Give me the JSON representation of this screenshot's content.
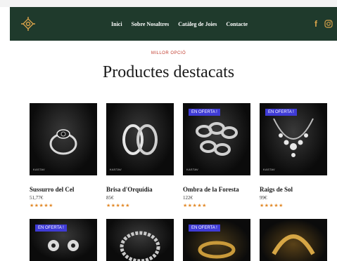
{
  "header": {
    "nav": [
      "Inici",
      "Sobre Nosaltres",
      "Catàleg de Joies",
      "Contacte"
    ],
    "social": {
      "facebook": "f",
      "instagram_icon": "instagram-icon"
    },
    "logo_icon": "jewel-logo-icon",
    "bg_color": "#1f3a2c"
  },
  "section": {
    "kicker": "MILLOR OPCIÓ",
    "title": "Productes destacats"
  },
  "products": [
    {
      "name": "Sussurro del Cel",
      "price": "51,77€",
      "badge": "",
      "brand": "KASTAV",
      "rating": 5,
      "icon": "ring-icon"
    },
    {
      "name": "Brisa d'Orquídia",
      "price": "85€",
      "badge": "",
      "brand": "KASTAV",
      "rating": 5,
      "icon": "hoop-earrings-icon"
    },
    {
      "name": "Ombra de la Foresta",
      "price": "122€",
      "badge": "EN OFERTA !",
      "brand": "KASTAV",
      "rating": 5,
      "icon": "chain-bracelet-icon"
    },
    {
      "name": "Raigs de Sol",
      "price": "99€",
      "badge": "EN OFERTA !",
      "brand": "KASTAV",
      "rating": 5,
      "icon": "necklace-icon"
    }
  ],
  "products_row2": [
    {
      "badge": "EN OFERTA !",
      "icon": "drop-earrings-icon"
    },
    {
      "badge": "",
      "icon": "bracelet-icon"
    },
    {
      "badge": "EN OFERTA !",
      "icon": "gold-bangle-icon"
    },
    {
      "badge": "",
      "icon": "gold-cuff-icon"
    }
  ],
  "accent_colors": {
    "badge": "#3f3bd6",
    "stars": "#e28a2a",
    "kicker": "#c0392b",
    "social": "#d8a24a"
  }
}
